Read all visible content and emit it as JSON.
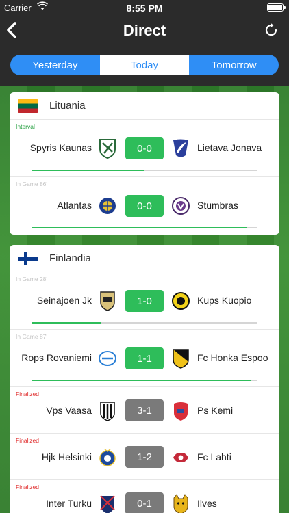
{
  "status_bar": {
    "carrier": "Carrier",
    "time": "8:55 PM"
  },
  "nav": {
    "title": "Direct"
  },
  "tabs": [
    {
      "label": "Yesterday",
      "active": false
    },
    {
      "label": "Today",
      "active": true
    },
    {
      "label": "Tomorrow",
      "active": false
    }
  ],
  "colors": {
    "accent": "#2f8ef5",
    "live_score": "#2ebd5a",
    "final_score": "#7a7a7a",
    "finalized_text": "#e03030"
  },
  "leagues": [
    {
      "country": "Lituania",
      "flag": "lithuania-flag",
      "matches": [
        {
          "status": "Interval",
          "home": "Spyris Kaunas",
          "away": "Lietava Jonava",
          "score": "0-0",
          "progress": 0.5,
          "home_icon": "spyris-crest-icon",
          "away_icon": "jonava-crest-icon"
        },
        {
          "status": "In Game 86'",
          "home": "Atlantas",
          "away": "Stumbras",
          "score": "0-0",
          "progress": 0.95,
          "home_icon": "atlantas-crest-icon",
          "away_icon": "stumbras-crest-icon"
        }
      ]
    },
    {
      "country": "Finlandia",
      "flag": "finland-flag",
      "matches": [
        {
          "status": "In Game 28'",
          "home": "Seinajoen Jk",
          "away": "Kups Kuopio",
          "score": "1-0",
          "progress": 0.31,
          "home_icon": "sjk-crest-icon",
          "away_icon": "kups-crest-icon"
        },
        {
          "status": "In Game 87'",
          "home": "Rops Rovaniemi",
          "away": "Fc Honka Espoo",
          "score": "1-1",
          "progress": 0.97,
          "home_icon": "rops-crest-icon",
          "away_icon": "honka-crest-icon"
        },
        {
          "status": "Finalized",
          "home": "Vps Vaasa",
          "away": "Ps Kemi",
          "score": "3-1",
          "home_icon": "vps-crest-icon",
          "away_icon": "pskemi-crest-icon"
        },
        {
          "status": "Finalized",
          "home": "Hjk Helsinki",
          "away": "Fc Lahti",
          "score": "1-2",
          "home_icon": "hjk-crest-icon",
          "away_icon": "lahti-crest-icon"
        },
        {
          "status": "Finalized",
          "home": "Inter Turku",
          "away": "Ilves",
          "score": "0-1",
          "home_icon": "inter-crest-icon",
          "away_icon": "ilves-crest-icon"
        }
      ]
    }
  ]
}
